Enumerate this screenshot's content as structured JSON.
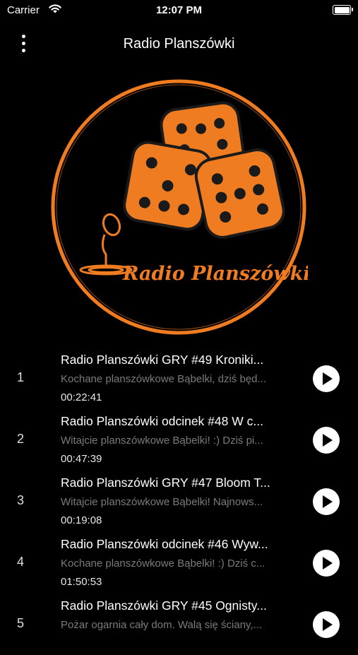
{
  "status_bar": {
    "carrier": "Carrier",
    "time": "12:07 PM",
    "battery_level": 1.0
  },
  "nav": {
    "title": "Radio Planszówki",
    "menu_icon": "more-vertical-icon"
  },
  "logo": {
    "text": "Radio Planszówki",
    "accent_color": "#f07c21"
  },
  "episodes": [
    {
      "index": "1",
      "title": "Radio Planszówki GRY #49 Kroniki...",
      "description": "Kochane planszówkowe Bąbelki, dziś będ...",
      "duration": "00:22:41"
    },
    {
      "index": "2",
      "title": "Radio Planszówki odcinek #48 W c...",
      "description": "Witajcie planszówkowe Bąbelki! :) Dziś pi...",
      "duration": "00:47:39"
    },
    {
      "index": "3",
      "title": "Radio Planszówki GRY #47 Bloom T...",
      "description": "Witajcie planszówkowe Bąbelki! Najnows...",
      "duration": "00:19:08"
    },
    {
      "index": "4",
      "title": "Radio Planszówki odcinek #46 Wyw...",
      "description": "Kochane planszówkowe Bąbelki! :) Dziś c...",
      "duration": "01:50:53"
    },
    {
      "index": "5",
      "title": "Radio Planszówki GRY #45 Ognisty...",
      "description": "Pożar ogarnia cały dom. Walą się ściany,...",
      "duration": ""
    }
  ]
}
